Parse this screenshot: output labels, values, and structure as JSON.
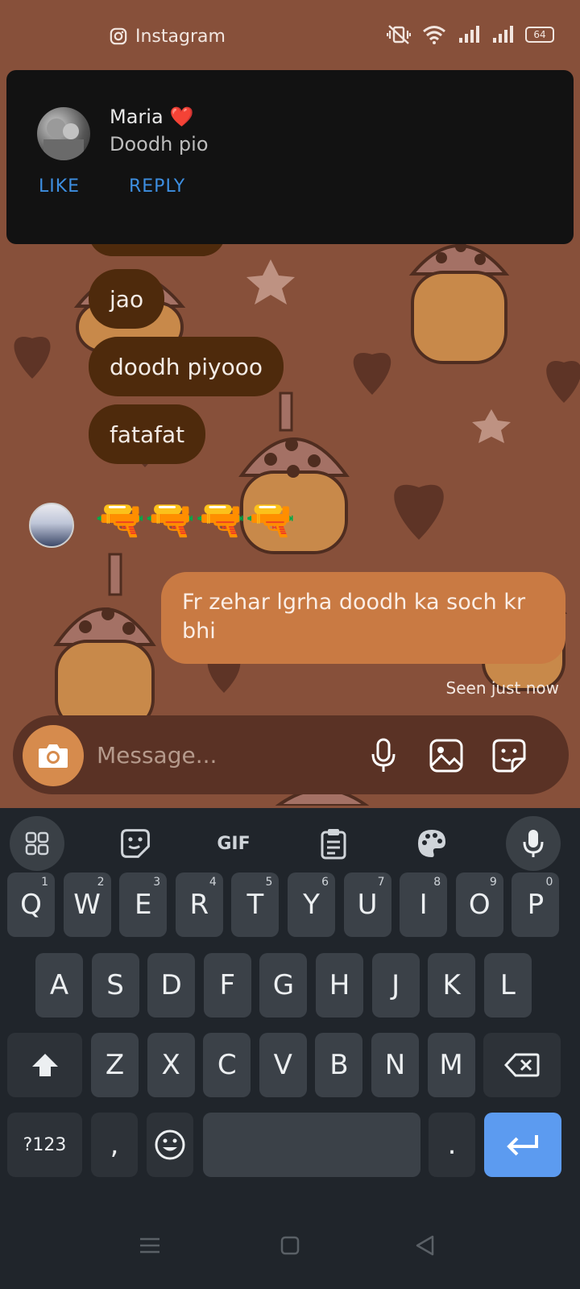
{
  "status_bar": {
    "app_name": "Instagram",
    "battery": "64",
    "icons": [
      "instagram-icon",
      "vibrate-off-icon",
      "wifi-icon",
      "signal-icon",
      "signal-icon",
      "battery-icon"
    ]
  },
  "notification": {
    "sender": "Maria",
    "sender_emoji": "❤️",
    "message": "Doodh pio",
    "like_label": "LIKE",
    "reply_label": "REPLY"
  },
  "chat": {
    "incoming_messages": [
      "jao",
      "doodh piyooo",
      "fatafat"
    ],
    "emoji_message": "🔫🔫🔫🔫",
    "outgoing_message": "Fr zehar lgrha doodh ka soch kr bhi",
    "seen_status": "Seen just now"
  },
  "composer": {
    "placeholder": "Message..."
  },
  "keyboard": {
    "toolbar": {
      "gif_label": "GIF",
      "icons": [
        "apps-grid-icon",
        "sticker-icon",
        "gif-icon",
        "clipboard-icon",
        "palette-icon",
        "mic-icon"
      ]
    },
    "row1": [
      {
        "key": "Q",
        "hint": "1"
      },
      {
        "key": "W",
        "hint": "2"
      },
      {
        "key": "E",
        "hint": "3"
      },
      {
        "key": "R",
        "hint": "4"
      },
      {
        "key": "T",
        "hint": "5"
      },
      {
        "key": "Y",
        "hint": "6"
      },
      {
        "key": "U",
        "hint": "7"
      },
      {
        "key": "I",
        "hint": "8"
      },
      {
        "key": "O",
        "hint": "9"
      },
      {
        "key": "P",
        "hint": "0"
      }
    ],
    "row2": [
      "A",
      "S",
      "D",
      "F",
      "G",
      "H",
      "J",
      "K",
      "L"
    ],
    "row3": [
      "Z",
      "X",
      "C",
      "V",
      "B",
      "N",
      "M"
    ],
    "symbols_label": "?123",
    "comma_label": ",",
    "period_label": "."
  },
  "colors": {
    "chat_background": "#87503a",
    "incoming_bubble": "#4e2a0c",
    "outgoing_bubble": "#c97a43",
    "notification_action": "#3d8ee0",
    "enter_key": "#5c9bf0"
  }
}
